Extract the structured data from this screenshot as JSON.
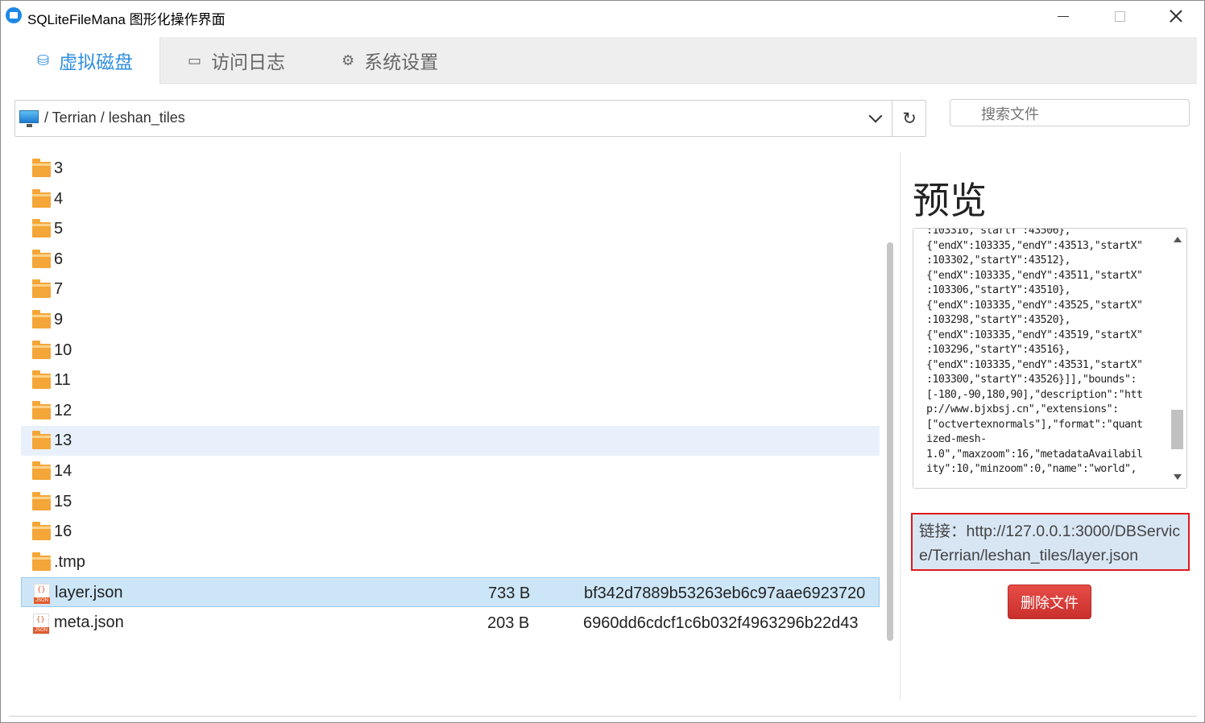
{
  "window": {
    "title": "SQLiteFileMana 图形化操作界面"
  },
  "tabs": [
    {
      "label": "虚拟磁盘",
      "icon": "drive-icon",
      "active": true
    },
    {
      "label": "访问日志",
      "icon": "monitor-icon",
      "active": false
    },
    {
      "label": "系统设置",
      "icon": "gear-icon",
      "active": false
    }
  ],
  "pathbar": {
    "path": "/ Terrian / leshan_tiles",
    "refresh_icon": "↻"
  },
  "search": {
    "placeholder": "搜索文件"
  },
  "files": [
    {
      "name": "3",
      "type": "folder",
      "size": "",
      "hash": ""
    },
    {
      "name": "4",
      "type": "folder",
      "size": "",
      "hash": ""
    },
    {
      "name": "5",
      "type": "folder",
      "size": "",
      "hash": ""
    },
    {
      "name": "6",
      "type": "folder",
      "size": "",
      "hash": ""
    },
    {
      "name": "7",
      "type": "folder",
      "size": "",
      "hash": ""
    },
    {
      "name": "9",
      "type": "folder",
      "size": "",
      "hash": ""
    },
    {
      "name": "10",
      "type": "folder",
      "size": "",
      "hash": ""
    },
    {
      "name": "11",
      "type": "folder",
      "size": "",
      "hash": ""
    },
    {
      "name": "12",
      "type": "folder",
      "size": "",
      "hash": ""
    },
    {
      "name": "13",
      "type": "folder",
      "size": "",
      "hash": "",
      "state": "hover"
    },
    {
      "name": "14",
      "type": "folder",
      "size": "",
      "hash": ""
    },
    {
      "name": "15",
      "type": "folder",
      "size": "",
      "hash": ""
    },
    {
      "name": "16",
      "type": "folder",
      "size": "",
      "hash": ""
    },
    {
      "name": ".tmp",
      "type": "folder",
      "size": "",
      "hash": ""
    },
    {
      "name": "layer.json",
      "type": "json",
      "size": "733 B",
      "hash": "bf342d7889b53263eb6c97aae6923720",
      "state": "selected"
    },
    {
      "name": "meta.json",
      "type": "json",
      "size": "203 B",
      "hash": "6960dd6cdcf1c6b032f4963296b22d43"
    }
  ],
  "preview": {
    "title": "预览",
    "content": ":103316,\"startY\":43506},\n{\"endX\":103335,\"endY\":43513,\"startX\"\n:103302,\"startY\":43512},\n{\"endX\":103335,\"endY\":43511,\"startX\"\n:103306,\"startY\":43510},\n{\"endX\":103335,\"endY\":43525,\"startX\"\n:103298,\"startY\":43520},\n{\"endX\":103335,\"endY\":43519,\"startX\"\n:103296,\"startY\":43516},\n{\"endX\":103335,\"endY\":43531,\"startX\"\n:103300,\"startY\":43526}]],\"bounds\":\n[-180,-90,180,90],\"description\":\"htt\np://www.bjxbsj.cn\",\"extensions\":\n[\"octvertexnormals\"],\"format\":\"quant\nized-mesh-\n1.0\",\"maxzoom\":16,\"metadataAvailabil\nity\":10,\"minzoom\":0,\"name\":\"world\","
  },
  "link": {
    "text": "链接：http://127.0.0.1:3000/DBService/Terrian/leshan_tiles/layer.json"
  },
  "actions": {
    "delete_label": "删除文件"
  }
}
